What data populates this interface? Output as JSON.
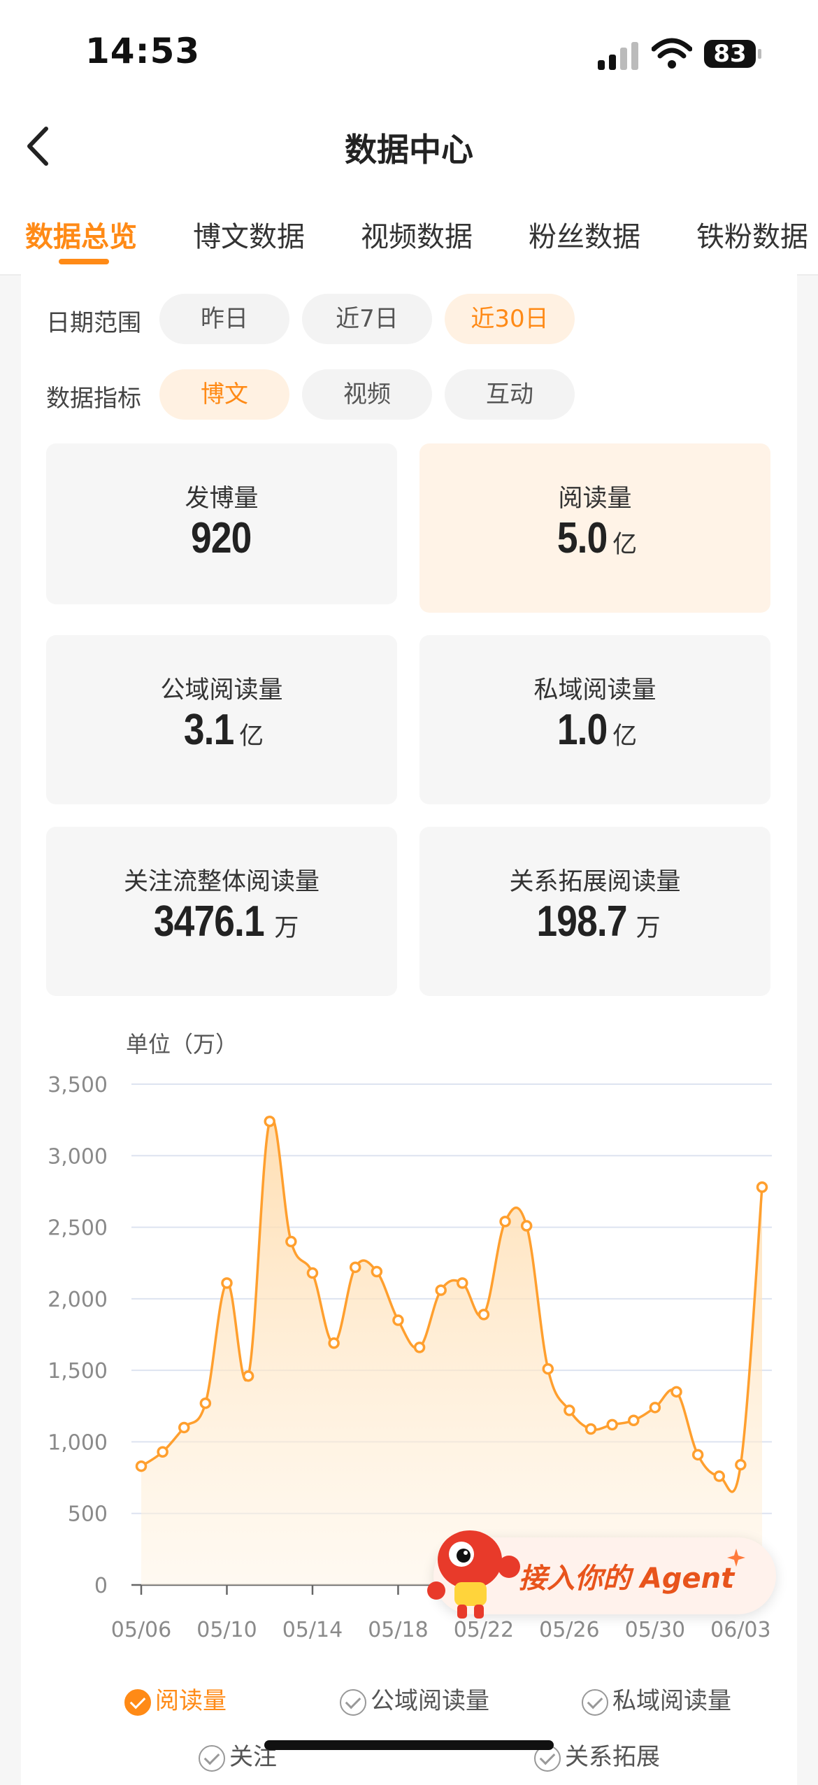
{
  "status_bar": {
    "time": "14:53",
    "battery": "83"
  },
  "nav": {
    "title": "数据中心"
  },
  "tabs": [
    "数据总览",
    "博文数据",
    "视频数据",
    "粉丝数据",
    "铁粉数据"
  ],
  "filters": {
    "date_label": "日期范围",
    "date_options": [
      "昨日",
      "近7日",
      "近30日"
    ],
    "date_selected": "近30日",
    "metric_label": "数据指标",
    "metric_options": [
      "博文",
      "视频",
      "互动"
    ],
    "metric_selected": "博文"
  },
  "stats": [
    {
      "label": "发博量",
      "value": "920",
      "unit": ""
    },
    {
      "label": "阅读量",
      "value": "5.0",
      "unit": "亿"
    },
    {
      "label": "公域阅读量",
      "value": "3.1",
      "unit": "亿"
    },
    {
      "label": "私域阅读量",
      "value": "1.0",
      "unit": "亿"
    },
    {
      "label": "关注流整体阅读量",
      "value": "3476.1",
      "unit": "万"
    },
    {
      "label": "关系拓展阅读量",
      "value": "198.7",
      "unit": "万"
    }
  ],
  "chart_data": {
    "type": "area",
    "unit_label": "单位（万）",
    "ylim": [
      0,
      3500
    ],
    "yticks": [
      "0",
      "500",
      "1,000",
      "1,500",
      "2,000",
      "2,500",
      "3,000",
      "3,500"
    ],
    "xtick_labels": [
      "05/06",
      "05/10",
      "05/14",
      "05/18",
      "05/22",
      "05/26",
      "05/30",
      "06/03"
    ],
    "x": [
      "05/06",
      "05/07",
      "05/08",
      "05/09",
      "05/10",
      "05/11",
      "05/12",
      "05/13",
      "05/14",
      "05/15",
      "05/16",
      "05/17",
      "05/18",
      "05/19",
      "05/20",
      "05/21",
      "05/22",
      "05/23",
      "05/24",
      "05/25",
      "05/26",
      "05/27",
      "05/28",
      "05/29",
      "05/30",
      "05/31",
      "06/01",
      "06/02",
      "06/03",
      "06/04"
    ],
    "series": [
      {
        "name": "阅读量",
        "color": "#ff9f2e",
        "values": [
          830,
          930,
          1100,
          1270,
          2110,
          1460,
          3240,
          2400,
          2180,
          1690,
          2220,
          2190,
          1850,
          1660,
          2060,
          2110,
          1890,
          2540,
          2510,
          1510,
          1220,
          1090,
          1120,
          1150,
          1240,
          1350,
          910,
          760,
          840,
          2780
        ]
      }
    ],
    "grid": true
  },
  "legend": [
    "阅读量",
    "公域阅读量",
    "私域阅读量",
    "关注",
    "关系拓展"
  ],
  "agent_banner": {
    "text": "接入你的 Agent"
  }
}
